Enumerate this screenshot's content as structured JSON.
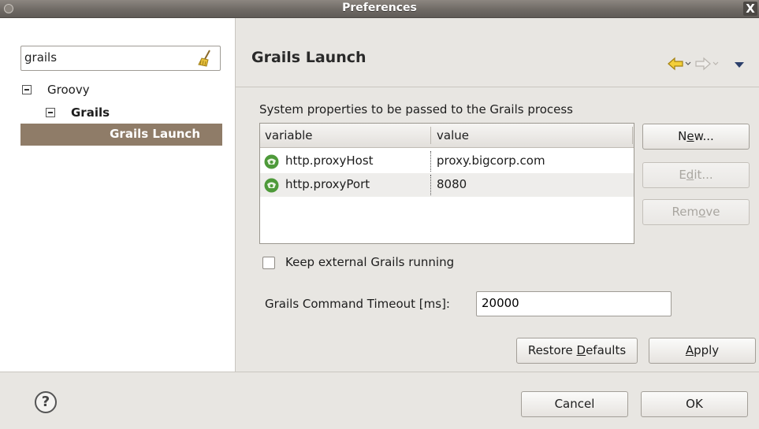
{
  "window": {
    "title": "Preferences",
    "close_glyph": "X"
  },
  "sidebar": {
    "filter_value": "grails",
    "filter_icon": "broom-icon",
    "tree": [
      {
        "label": "Groovy",
        "level": 0,
        "expanded": true
      },
      {
        "label": "Grails",
        "level": 1,
        "expanded": true
      },
      {
        "label": "Grails Launch",
        "level": 2,
        "selected": true
      }
    ]
  },
  "page": {
    "title": "Grails Launch",
    "nav": {
      "back": "⇦",
      "back_menu": "⌄",
      "forward": "⇨",
      "forward_menu": "⌄",
      "view_menu": "▼"
    },
    "table_caption": "System properties to be passed to the Grails process",
    "table": {
      "columns": [
        "variable",
        "value"
      ],
      "rows": [
        {
          "variable": "http.proxyHost",
          "value": "proxy.bigcorp.com"
        },
        {
          "variable": "http.proxyPort",
          "value": "8080"
        }
      ]
    },
    "buttons": {
      "new": {
        "pre": "N",
        "u": "e",
        "post": "w..."
      },
      "edit": {
        "pre": "E",
        "u": "d",
        "post": "it..."
      },
      "remove": {
        "pre": "Rem",
        "u": "o",
        "post": "ve"
      },
      "restore": {
        "pre": "Restore ",
        "u": "D",
        "post": "efaults"
      },
      "apply": {
        "pre": "",
        "u": "A",
        "post": "pply"
      }
    },
    "keep_running_label": "Keep external Grails running",
    "keep_running_checked": false,
    "timeout_label": "Grails Command Timeout [ms]:",
    "timeout_value": "20000"
  },
  "footer": {
    "help": "?",
    "cancel": "Cancel",
    "ok": "OK"
  },
  "colors": {
    "selection": "#8f7c68",
    "nav_arrow": "#e8b300"
  }
}
